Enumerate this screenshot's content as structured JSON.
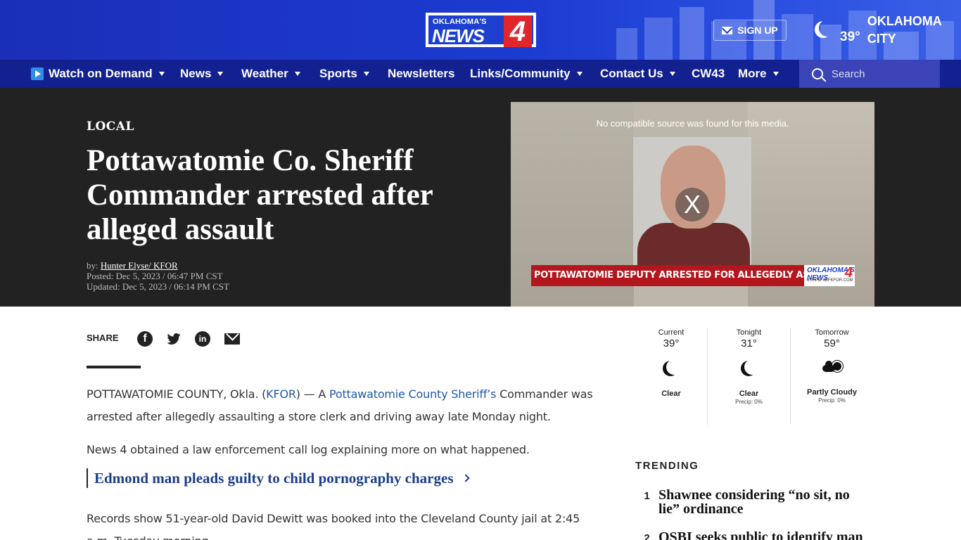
{
  "header": {
    "logo_top": "OKLAHOMA'S",
    "logo_main": "NEWS",
    "logo_number": "4",
    "signup_label": "SIGN UP",
    "weather_temp": "39°",
    "weather_city": "OKLAHOMA CITY"
  },
  "nav": {
    "items": [
      {
        "label": "Watch on Demand",
        "dropdown": true
      },
      {
        "label": "News",
        "dropdown": true
      },
      {
        "label": "Weather",
        "dropdown": true
      },
      {
        "label": "Sports",
        "dropdown": true
      },
      {
        "label": "Newsletters",
        "dropdown": false
      },
      {
        "label": "Links/Community",
        "dropdown": true
      },
      {
        "label": "Contact Us",
        "dropdown": true
      },
      {
        "label": "CW43",
        "dropdown": false
      },
      {
        "label": "More",
        "dropdown": true
      }
    ],
    "search_placeholder": "Search"
  },
  "article": {
    "category": "LOCAL",
    "headline": "Pottawatomie Co. Sheriff Commander arrested after alleged assault",
    "byline_prefix": "by:",
    "author": "Hunter Elyse/ KFOR",
    "posted": "Posted: Dec 5, 2023 / 06:47 PM CST",
    "updated": "Updated: Dec 5, 2023 / 06:14 PM CST",
    "video": {
      "error_message": "No compatible source was found for this media.",
      "close_symbol": "X",
      "lower_third": "POTTAWATOMIE DEPUTY ARRESTED FOR ALLEGEDLY ASSAULTING CLERK",
      "lower_third_logo": "OKLAHOMA'S NEWS",
      "lower_third_logo_num": "4",
      "lower_third_small": "6:00PM 4BFKFOR.COM"
    },
    "share_label": "SHARE",
    "p1_start": "POTTAWATOMIE COUNTY, Okla. (",
    "p1_link1": "KFOR",
    "p1_mid": ") — A ",
    "p1_link2": "Pottawatomie County Sheriff’s",
    "p1_end": " Commander was arrested after allegedly assaulting a store clerk and driving away late Monday night.",
    "p2": "News 4 obtained a law enforcement call log explaining more on what happened.",
    "related_link": "Edmond man pleads guilty to child pornography charges",
    "p3": "Records show 51-year-old David Dewitt was booked into the Cleveland County jail at 2:45 a.m. Tuesday morning."
  },
  "weather": [
    {
      "label": "Current",
      "temp": "39°",
      "icon": "moon-icon",
      "condition": "Clear",
      "precip": ""
    },
    {
      "label": "Tonight",
      "temp": "31°",
      "icon": "moon-icon",
      "condition": "Clear",
      "precip": "Precip: 0%"
    },
    {
      "label": "Tomorrow",
      "temp": "59°",
      "icon": "partly-cloudy-icon",
      "condition": "Partly Cloudy",
      "precip": "Precip: 0%"
    }
  ],
  "trending": {
    "title": "TRENDING",
    "items": [
      {
        "num": "1",
        "text": "Shawnee considering “no sit, no lie” ordinance"
      },
      {
        "num": "2",
        "text": "OSBI seeks public to identify man"
      }
    ]
  },
  "colors": {
    "header_blue": "#1d3bd1",
    "nav_blue": "#13208f",
    "link_blue": "#1f59a6",
    "hero_bg": "#222222",
    "brand_red": "#e0252b"
  }
}
